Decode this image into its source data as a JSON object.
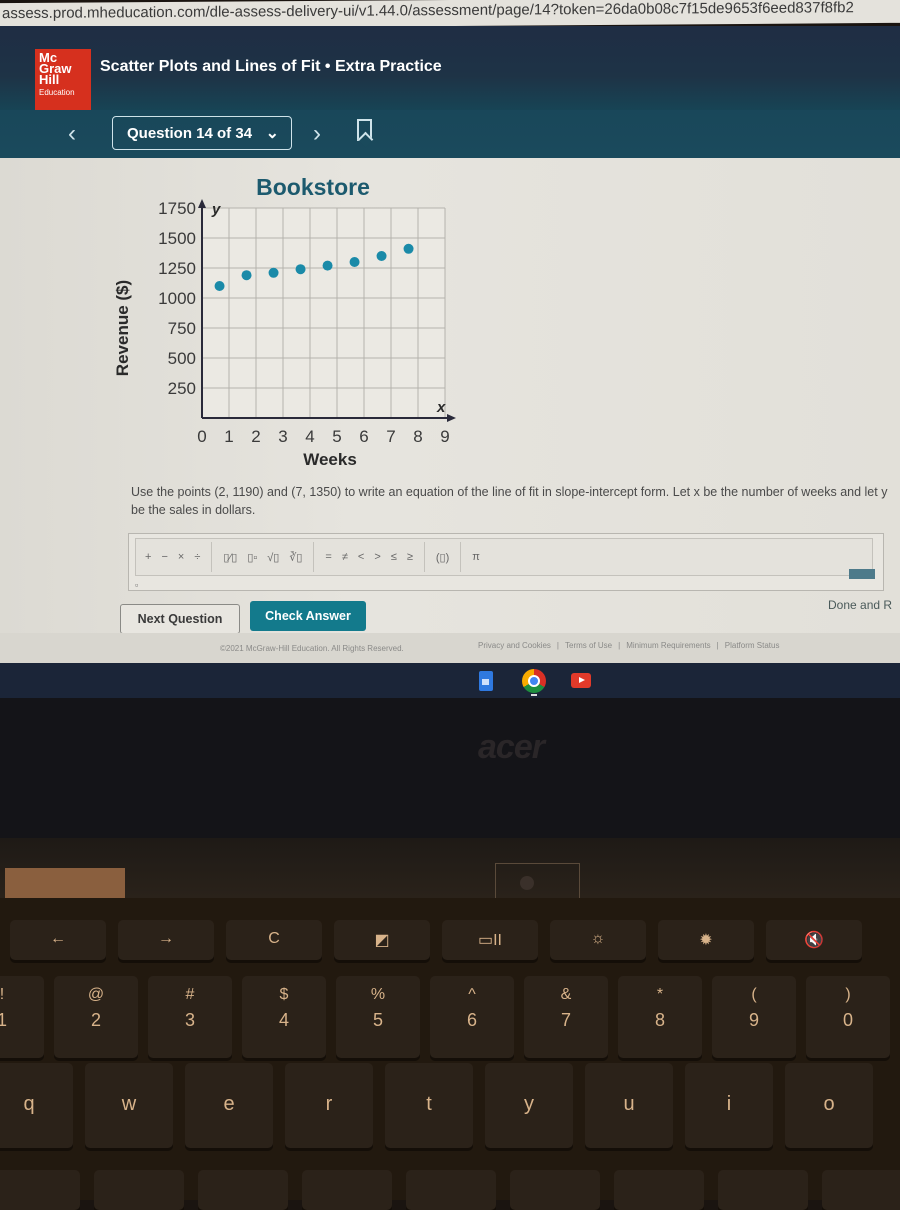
{
  "browser": {
    "url": "assess.prod.mheducation.com/dle-assess-delivery-ui/v1.44.0/assessment/page/14?token=26da0b08c7f15de9653f6eed837f8fb2"
  },
  "header": {
    "logo_lines": [
      "Mc",
      "Graw",
      "Hill",
      "Education"
    ],
    "title": "Scatter Plots and Lines of Fit • Extra Practice"
  },
  "nav": {
    "prev_icon": "‹",
    "question_selector": "Question 14 of 34",
    "chevron": "⌄",
    "next_icon": "›"
  },
  "chart_data": {
    "type": "scatter",
    "title": "Bookstore",
    "xlabel": "Weeks",
    "ylabel": "Revenue ($)",
    "x_axis_letter": "x",
    "y_axis_letter": "y",
    "xlim": [
      0,
      9
    ],
    "ylim": [
      0,
      1750
    ],
    "x_ticks": [
      "0",
      "1",
      "2",
      "3",
      "4",
      "5",
      "6",
      "7",
      "8",
      "9"
    ],
    "y_ticks": [
      "250",
      "500",
      "750",
      "1000",
      "1250",
      "1500",
      "1750"
    ],
    "grid": true,
    "color": "#1a8aa8",
    "points": [
      {
        "x": 1,
        "y": 1100
      },
      {
        "x": 2,
        "y": 1190
      },
      {
        "x": 3,
        "y": 1210
      },
      {
        "x": 4,
        "y": 1240
      },
      {
        "x": 5,
        "y": 1270
      },
      {
        "x": 6,
        "y": 1300
      },
      {
        "x": 7,
        "y": 1350
      },
      {
        "x": 8,
        "y": 1410
      }
    ]
  },
  "question": {
    "prompt": "Use the points (2, 1190) and (7, 1350) to write an equation of the line of fit in slope-intercept form. Let x be the number of weeks and let y be the sales in dollars."
  },
  "math_toolbar": {
    "groups": [
      [
        "+",
        "−",
        "×",
        "÷"
      ],
      [
        "▯⁄▯",
        "▯▫",
        "√▯",
        "∛▯"
      ],
      [
        "=",
        "≠",
        "<",
        ">",
        "≤",
        "≥"
      ],
      [
        "(▯)"
      ],
      [
        "π"
      ]
    ]
  },
  "answer": {
    "value": "",
    "cursor": "▫"
  },
  "buttons": {
    "next_question": "Next Question",
    "check_answer": "Check Answer",
    "done": "Done and R"
  },
  "footer": {
    "copyright": "©2021 McGraw-Hill Education. All Rights Reserved.",
    "links": [
      "Privacy and Cookies",
      "Terms of Use",
      "Minimum Requirements",
      "Platform Status"
    ]
  },
  "taskbar": {
    "apps": [
      "docs-icon",
      "chrome-icon",
      "youtube-icon"
    ]
  },
  "laptop": {
    "brand": "acer"
  },
  "keyboard": {
    "function_row": [
      "←",
      "→",
      "C",
      "◩",
      "▭II",
      "☼",
      "✹",
      "🔇"
    ],
    "number_row": [
      {
        "top": "!",
        "bottom": "1"
      },
      {
        "top": "@",
        "bottom": "2"
      },
      {
        "top": "#",
        "bottom": "3"
      },
      {
        "top": "$",
        "bottom": "4"
      },
      {
        "top": "%",
        "bottom": "5"
      },
      {
        "top": "^",
        "bottom": "6"
      },
      {
        "top": "&",
        "bottom": "7"
      },
      {
        "top": "*",
        "bottom": "8"
      },
      {
        "top": "(",
        "bottom": "9"
      },
      {
        "top": ")",
        "bottom": "0"
      }
    ],
    "letter_row": [
      "q",
      "w",
      "e",
      "r",
      "t",
      "y",
      "u",
      "i",
      "o"
    ]
  }
}
